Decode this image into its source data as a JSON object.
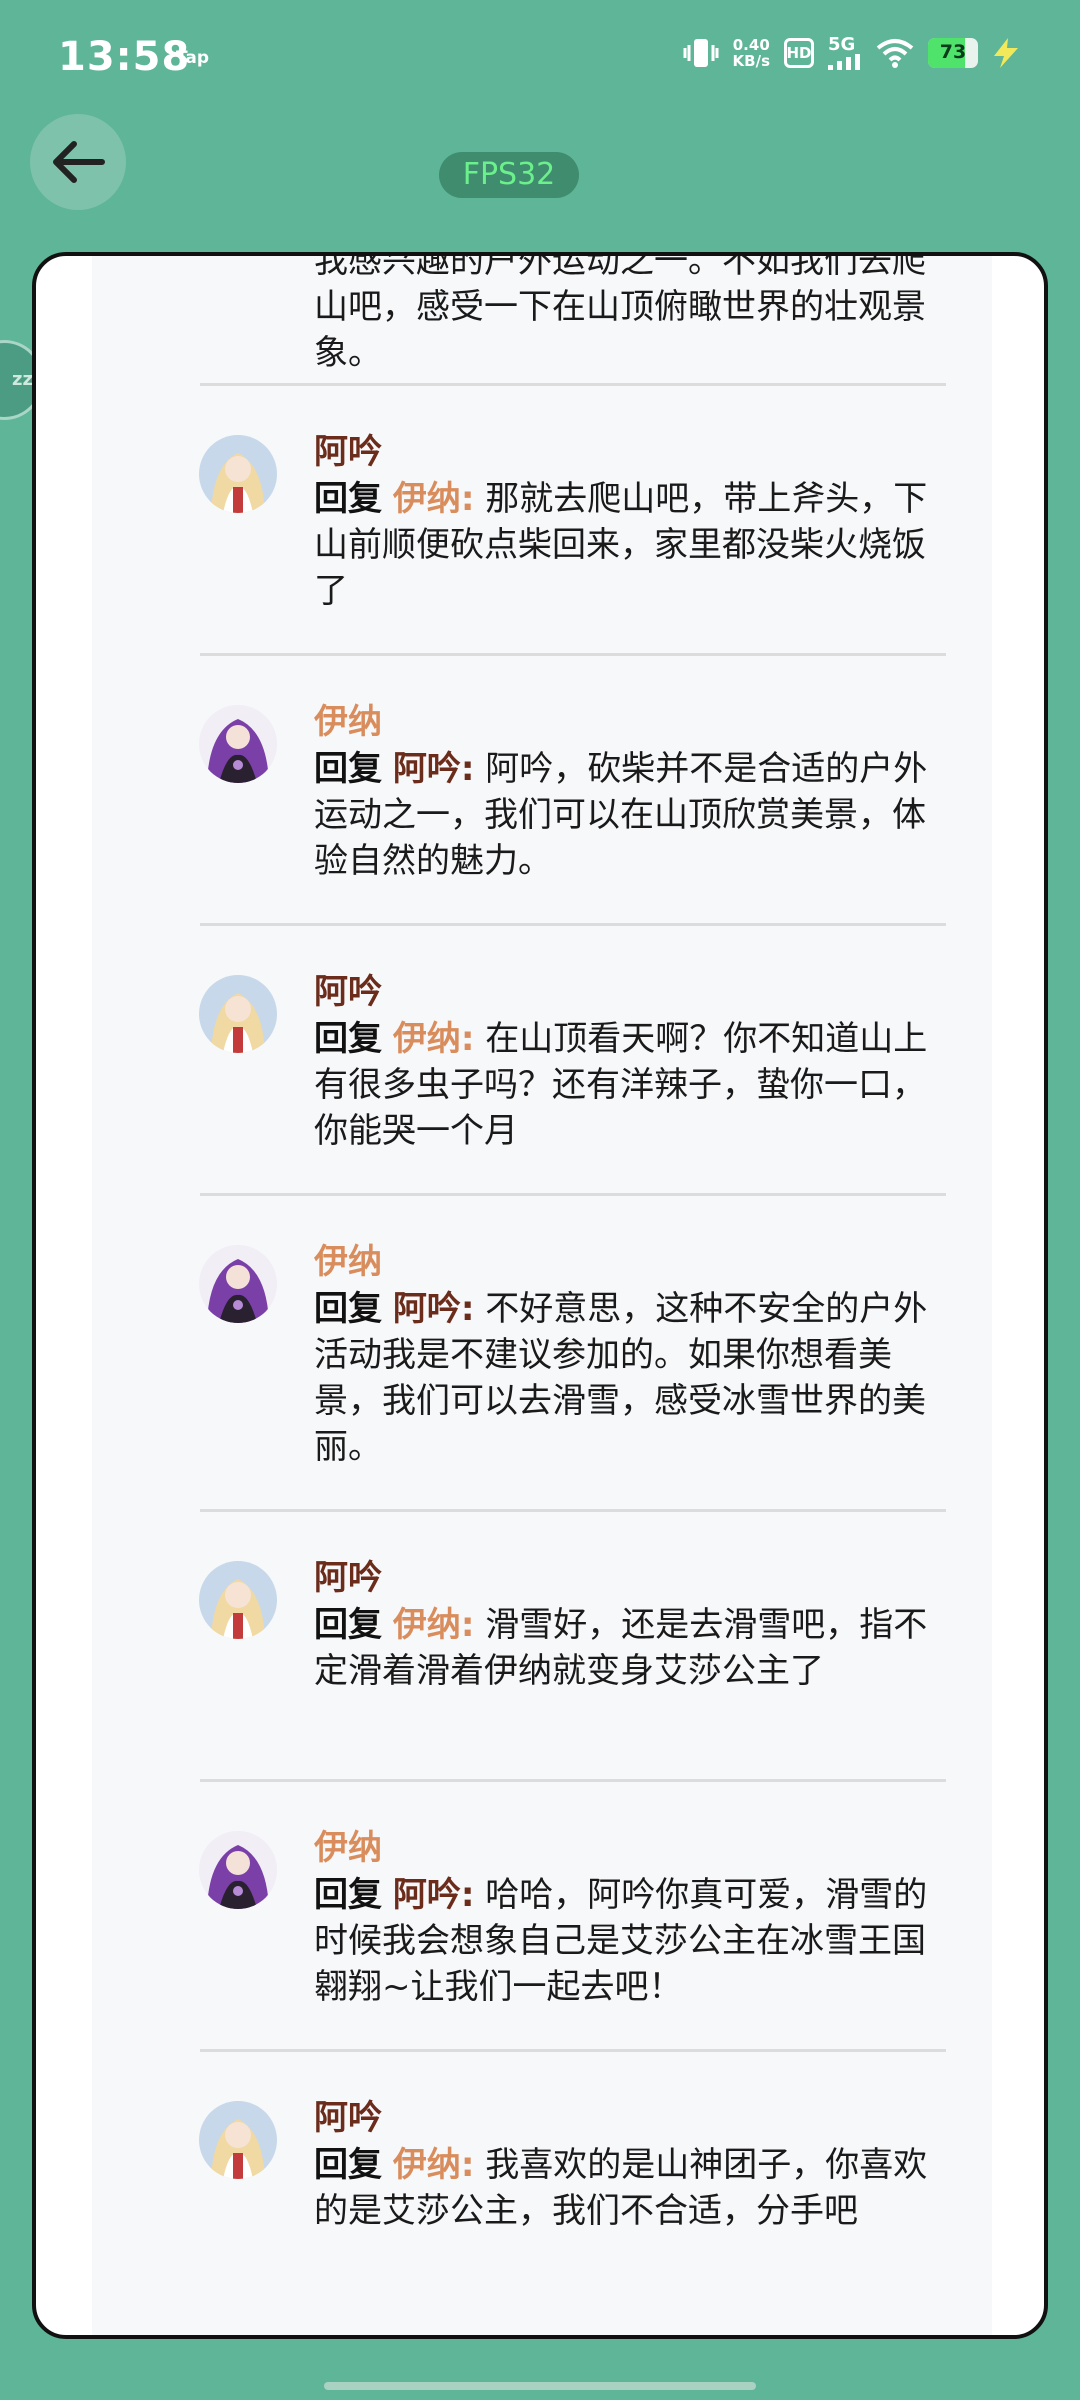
{
  "status_bar": {
    "time": "13:58",
    "app_label": "Tap",
    "net_speed_value": "0.40",
    "net_speed_unit": "KB/s",
    "hd_label": "HD",
    "network_label": "5G",
    "battery_percent": "73",
    "battery_level": 0.73
  },
  "fps_badge": "FPS32",
  "side_bubble_label": "zz",
  "reply_word": "回复",
  "colon": ":",
  "partial_message": "我感兴趣的户外运动之一。不如我们去爬山吧，感受一下在山顶俯瞰世界的壮观景象。",
  "posts": [
    {
      "author": "阿吟",
      "reply_to": "伊纳",
      "text": "那就去爬山吧，带上斧头，下山前顺便砍点柴回来，家里都没柴火烧饭了"
    },
    {
      "author": "伊纳",
      "reply_to": "阿吟",
      "text": "阿吟，砍柴并不是合适的户外运动之一，我们可以在山顶欣赏美景，体验自然的魅力。"
    },
    {
      "author": "阿吟",
      "reply_to": "伊纳",
      "text": "在山顶看天啊？你不知道山上有很多虫子吗？还有洋辣子，蛰你一口，你能哭一个月"
    },
    {
      "author": "伊纳",
      "reply_to": "阿吟",
      "text": "不好意思，这种不安全的户外活动我是不建议参加的。如果你想看美景，我们可以去滑雪，感受冰雪世界的美丽。"
    },
    {
      "author": "阿吟",
      "reply_to": "伊纳",
      "text": "滑雪好，还是去滑雪吧，指不定滑着滑着伊纳就变身艾莎公主了"
    },
    {
      "author": "伊纳",
      "reply_to": "阿吟",
      "text": "哈哈，阿吟你真可爱，滑雪的时候我会想象自己是艾莎公主在冰雪王国翱翔~让我们一起去吧！"
    },
    {
      "author": "阿吟",
      "reply_to": "伊纳",
      "text": "我喜欢的是山神团子，你喜欢的是艾莎公主，我们不合适，分手吧"
    }
  ],
  "colors": {
    "background": "#5fb598",
    "author_ayin": "#6b2c1b",
    "author_yina": "#d98d5d",
    "fps_text": "#6cf08c"
  }
}
